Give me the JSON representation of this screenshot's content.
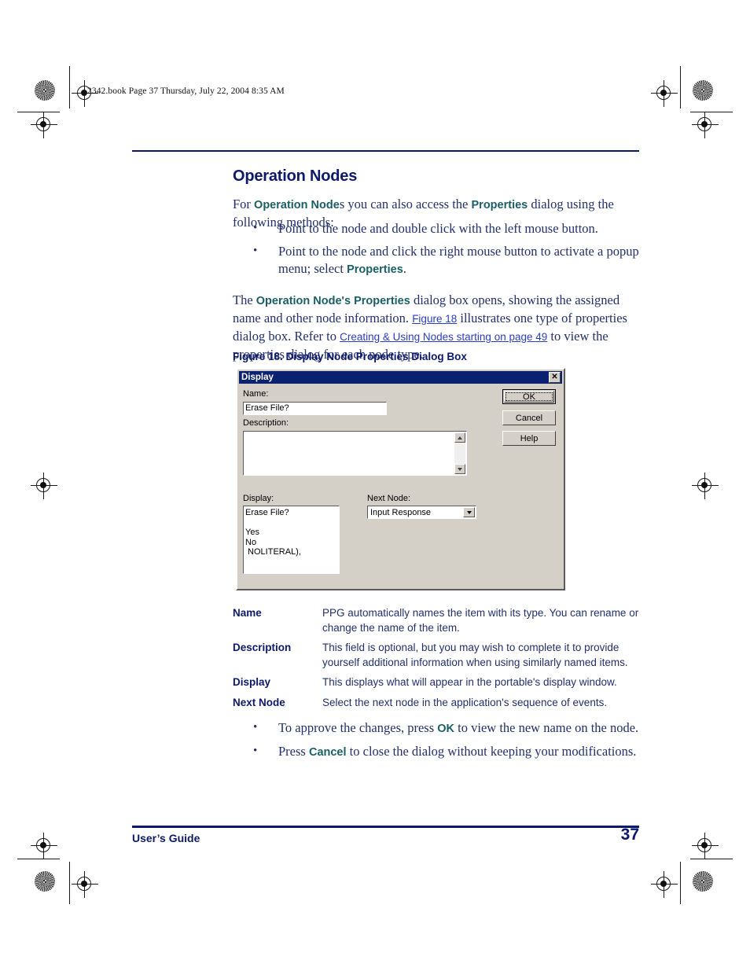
{
  "page": {
    "file_stamp": "2342.book  Page 37  Thursday, July 22, 2004  8:35 AM",
    "heading": "Operation Nodes",
    "footer_left": "User’s Guide",
    "footer_page": "37",
    "accent_navy": "#0d1a6b",
    "body_navy": "#23306b",
    "bold_term_teal": "#1a5f66",
    "link_blue": "#2a3ec2"
  },
  "intro": {
    "part1": "For ",
    "term1": "Operation Node",
    "part2": "s you can also access the ",
    "term2": "Properties",
    "part3": " dialog using the following methods:"
  },
  "method_bullets": [
    {
      "part1": "Point to the node and double click with the left mouse button.",
      "term": "",
      "part2": ""
    },
    {
      "part1": "Point to the node and click the right mouse button to activate a popup menu; select ",
      "term": "Properties",
      "part2": "."
    }
  ],
  "para2": {
    "part1": "The ",
    "term1": "Operation Node's Properties",
    "part2": " dialog box opens, showing the assigned name and other node information. ",
    "link1": "Figure 18",
    "part3": " illustrates one type of properties dialog box. Refer to ",
    "link2": "Creating & Using Nodes starting on page 49",
    "part4": " to view the properties dialog for each node type."
  },
  "figure": {
    "caption": "Figure 18. Display Node Properties Dialog Box",
    "dialog": {
      "title": "Display",
      "close_label": "✕",
      "name_label": "Name:",
      "name_value": "Erase File?",
      "description_label": "Description:",
      "description_value": "",
      "display_label": "Display:",
      "display_value": "Erase File?\n\nYes\nNo\n NOLITERAL),",
      "next_node_label": "Next Node:",
      "next_node_value": "Input Response",
      "buttons": {
        "ok": "OK",
        "cancel": "Cancel",
        "help": "Help"
      }
    }
  },
  "definitions": [
    {
      "term": "Name",
      "desc": "PPG automatically names the item with its type. You can rename or change the name of the item."
    },
    {
      "term": "Description",
      "desc": "This field is optional, but you may wish to complete it to provide yourself additional information when using similarly named items."
    },
    {
      "term": "Display",
      "desc": "This displays what will appear in the portable's display window."
    },
    {
      "term": "Next Node",
      "desc": "Select the next node in the application's sequence of events."
    }
  ],
  "action_bullets": [
    {
      "part1": "To approve the changes, press ",
      "term": "OK",
      "part2": " to view the new name on the node."
    },
    {
      "part1": "Press ",
      "term": "Cancel",
      "part2": " to close the dialog without keeping your modifications."
    }
  ]
}
